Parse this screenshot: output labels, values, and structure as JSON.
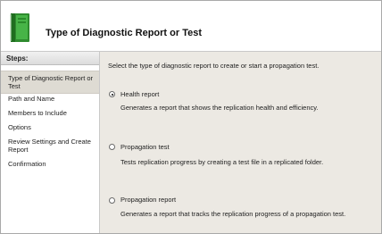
{
  "header": {
    "title": "Type of Diagnostic Report or Test",
    "icon": "green-book-icon"
  },
  "sidebar": {
    "steps_label": "Steps:",
    "items": [
      {
        "label": "Type of Diagnostic Report or Test",
        "active": true
      },
      {
        "label": "Path and Name",
        "active": false
      },
      {
        "label": "Members to Include",
        "active": false
      },
      {
        "label": "Options",
        "active": false
      },
      {
        "label": "Review Settings and Create Report",
        "active": false
      },
      {
        "label": "Confirmation",
        "active": false
      }
    ]
  },
  "main": {
    "instruction": "Select the type of diagnostic report to create or start a propagation test.",
    "options": [
      {
        "label": "Health report",
        "description": "Generates a report that shows the replication health and efficiency.",
        "selected": true
      },
      {
        "label": "Propagation test",
        "description": "Tests replication progress by creating a test file in a replicated folder.",
        "selected": false
      },
      {
        "label": "Propagation report",
        "description": "Generates a report that tracks the replication progress of a propagation test.",
        "selected": false
      }
    ]
  },
  "colors": {
    "content_bg": "#ece9e3",
    "active_step_bg": "#dedbd3",
    "icon_green": "#3aa33a"
  }
}
